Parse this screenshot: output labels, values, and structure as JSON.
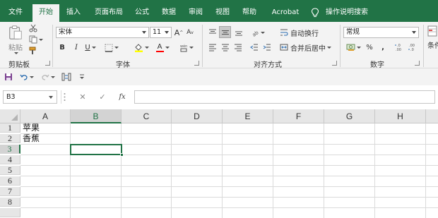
{
  "menu": {
    "tabs": [
      "文件",
      "开始",
      "插入",
      "页面布局",
      "公式",
      "数据",
      "审阅",
      "视图",
      "帮助",
      "Acrobat"
    ],
    "active_tab": "开始",
    "tell_me": "操作说明搜索"
  },
  "ribbon": {
    "clipboard": {
      "paste": "粘贴",
      "label": "剪贴板"
    },
    "font": {
      "name": "宋体",
      "size": "11",
      "bold": "B",
      "italic": "I",
      "underline": "U",
      "grow": "A",
      "shrink": "A",
      "font_color_letter": "A",
      "label": "字体",
      "fill_color": "#ffff00",
      "font_color": "#ff0000"
    },
    "alignment": {
      "wrap": "自动换行",
      "merge": "合并后居中",
      "label": "对齐方式"
    },
    "number": {
      "format": "常规",
      "percent": "%",
      "comma": ",",
      "label": "数字"
    },
    "styles_partial": "条件"
  },
  "qat": {
    "items": [
      "save-icon",
      "undo-icon",
      "redo-icon",
      "customize-icon"
    ]
  },
  "formula_bar": {
    "name_box": "B3",
    "cancel": "✕",
    "enter": "✓",
    "fx": "fx",
    "content": ""
  },
  "sheet": {
    "columns": [
      "A",
      "B",
      "C",
      "D",
      "E",
      "F",
      "G",
      "H"
    ],
    "rows": [
      "1",
      "2",
      "3",
      "4",
      "5",
      "6",
      "7",
      "8"
    ],
    "cells": {
      "A1": "苹果",
      "A2": "香蕉"
    },
    "selected_cell": "B3",
    "accent": "#217346"
  }
}
